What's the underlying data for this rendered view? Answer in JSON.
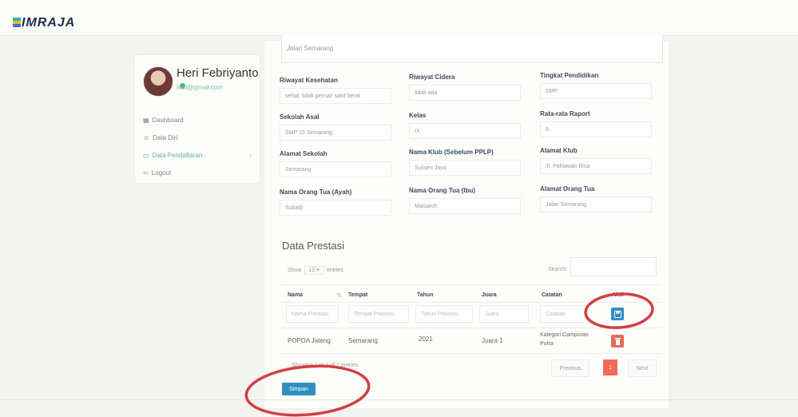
{
  "app": {
    "logo_text": "IMRAJA"
  },
  "user": {
    "name": "Heri Febriyanto",
    "email": "heri@gmail.com"
  },
  "sidebar": {
    "items": [
      {
        "label": "Dashboard",
        "icon": "grid-icon"
      },
      {
        "label": "Data Diri",
        "icon": "user-icon"
      },
      {
        "label": "Data Pendaftaran",
        "icon": "folder-icon"
      },
      {
        "label": "Logout",
        "icon": "logout-icon"
      }
    ]
  },
  "form": {
    "address_value": "Jalan Semarang",
    "fields": [
      {
        "label": "Riwayat Kesehatan",
        "value": "sehat, tidak pernah sakit berat"
      },
      {
        "label": "Riwayat Cidera",
        "value": "tidak ada"
      },
      {
        "label": "Tingkat Pendidikan",
        "value": "SMP"
      },
      {
        "label": "Sekolah Asal",
        "value": "SMP 15 Semarang"
      },
      {
        "label": "Kelas",
        "value": "IX"
      },
      {
        "label": "Rata-rata Raport",
        "value": "8"
      },
      {
        "label": "Alamat Sekolah",
        "value": "Semarang"
      },
      {
        "label": "Nama Klub (Sebelum PPLP)",
        "value": "Sukses Jaya"
      },
      {
        "label": "Alamat Klub",
        "value": "Jl. Pahlawan Bisa"
      },
      {
        "label": "Nama Orang Tua (Ayah)",
        "value": "Subadi"
      },
      {
        "label": "Nama Orang Tua (Ibu)",
        "value": "Maisaroh"
      },
      {
        "label": "Alamat Orang Tua",
        "value": "Jalan Semarang"
      }
    ]
  },
  "prestasi": {
    "title": "Data Prestasi",
    "show_label": "Show",
    "show_value": "10",
    "entries_label": "entries",
    "search_label": "Search:",
    "columns": [
      "Nama",
      "Tempat",
      "Tahun",
      "Juara",
      "Catatan",
      "Aksi"
    ],
    "placeholders": [
      "Nama Prestasi",
      "Tempat Prestasi",
      "Tahun Prestasi",
      "Juara",
      "Catatan"
    ],
    "rows": [
      {
        "nama": "POPDA Jateng",
        "tempat": "Semarang",
        "tahun": "2021",
        "juara": "Juara 1",
        "catatan": "Kategori Campuran Putra"
      }
    ],
    "showing_text": "Showing 1 to 1 of 1 entries",
    "prev_label": "Previous",
    "page": "1",
    "next_label": "Next"
  },
  "actions": {
    "save_label": "Simpan"
  },
  "colors": {
    "primary": "#2f8fbf",
    "danger": "#e36b5c",
    "annotation": "#d04040"
  }
}
